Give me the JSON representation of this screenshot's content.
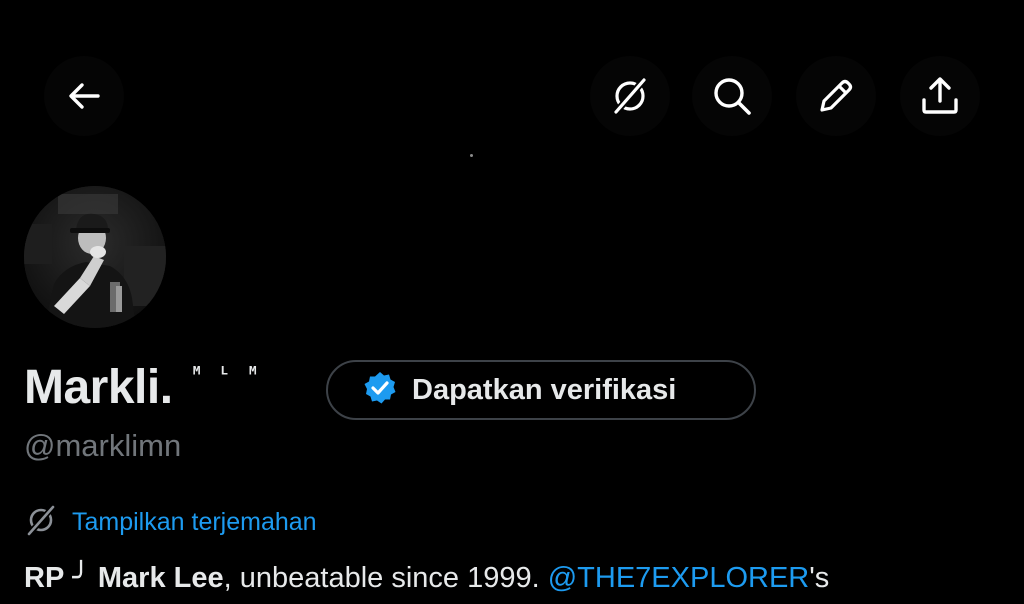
{
  "header": {
    "back_icon": "arrow-left-icon",
    "incognito_icon": "translate-off-icon",
    "search_icon": "search-icon",
    "edit_icon": "pencil-icon",
    "share_icon": "share-icon"
  },
  "profile": {
    "display_name": "Markli.",
    "name_tag": "ᴹ ᴸ ᴹ",
    "handle": "@marklimn",
    "verify_button": {
      "label": "Dapatkan verifikasi",
      "badge_color": "#1d9bf0"
    },
    "translate": {
      "label": "Tampilkan terjemahan"
    },
    "bio": {
      "prefix": "RP",
      "separator": "╯",
      "bold_name": "Mark Lee",
      "text": ", unbeatable since 1999. ",
      "mention": "@THE7EXPLORER",
      "suffix": "'s"
    }
  },
  "colors": {
    "background": "#000000",
    "text_primary": "#e7e9ea",
    "text_secondary": "#71767b",
    "link": "#1d9bf0",
    "border": "#3d4248"
  }
}
